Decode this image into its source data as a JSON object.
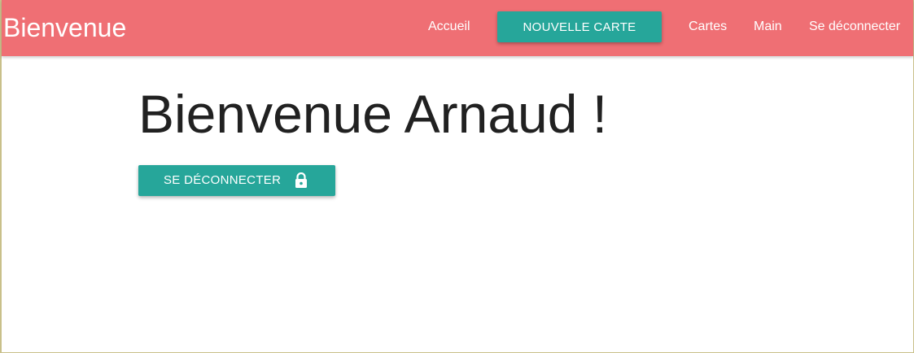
{
  "navbar": {
    "brand": "Bienvenue",
    "links": {
      "home": "Accueil",
      "new_card": "NOUVELLE CARTE",
      "cards": "Cartes",
      "hand": "Main",
      "logout": "Se déconnecter"
    },
    "background_color": "#ef6f74"
  },
  "main": {
    "welcome_text": "Bienvenue Arnaud !",
    "logout_button_label": "SE DÉCONNECTER",
    "logout_button_icon": "lock-icon",
    "button_color": "#26a69a"
  }
}
